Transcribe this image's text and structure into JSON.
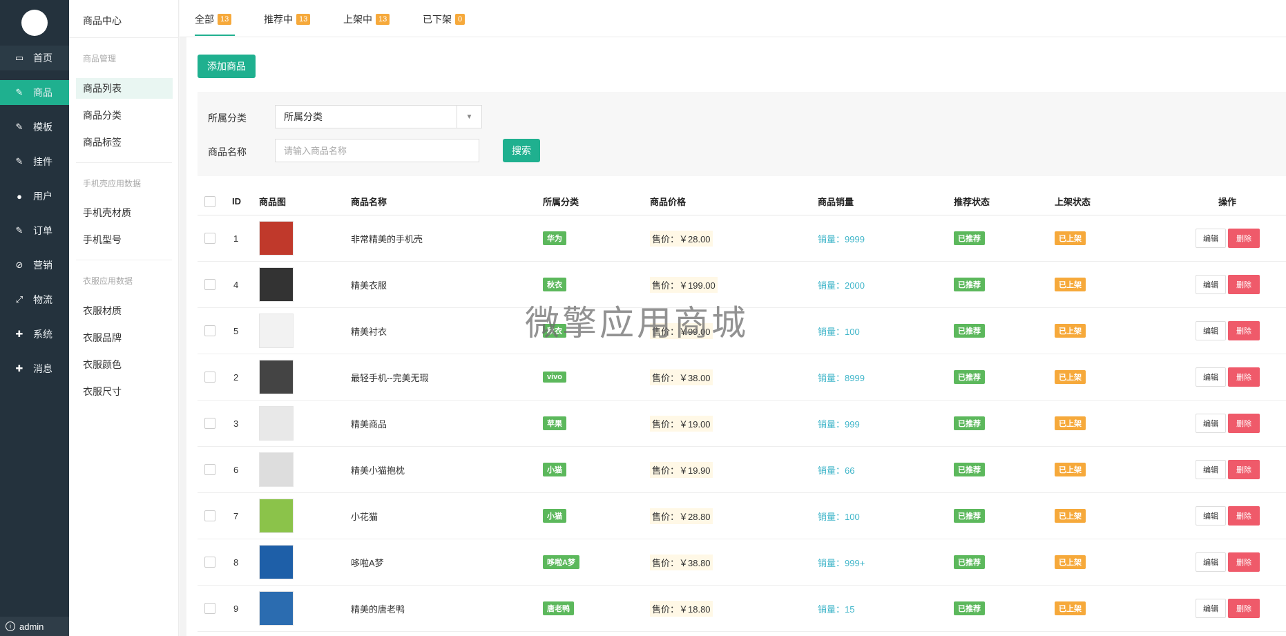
{
  "sidebar": {
    "items": [
      {
        "label": "首页",
        "icon": "monitor-icon",
        "glyph": "▭"
      },
      {
        "label": "商品",
        "icon": "pencil-icon",
        "glyph": "✎"
      },
      {
        "label": "模板",
        "icon": "pencil-icon",
        "glyph": "✎"
      },
      {
        "label": "挂件",
        "icon": "pencil-icon",
        "glyph": "✎"
      },
      {
        "label": "用户",
        "icon": "user-icon",
        "glyph": "●"
      },
      {
        "label": "订单",
        "icon": "pencil-icon",
        "glyph": "✎"
      },
      {
        "label": "营销",
        "icon": "ban-icon",
        "glyph": "⊘"
      },
      {
        "label": "物流",
        "icon": "expand-icon",
        "glyph": "⤢"
      },
      {
        "label": "系统",
        "icon": "plus-icon",
        "glyph": "✚"
      },
      {
        "label": "消息",
        "icon": "plus-icon",
        "glyph": "✚"
      }
    ],
    "user": "admin"
  },
  "subnav": {
    "header": "商品中心",
    "groups": [
      {
        "title": "商品管理",
        "items": [
          "商品列表",
          "商品分类",
          "商品标签"
        ]
      },
      {
        "title": "手机壳应用数据",
        "items": [
          "手机壳材质",
          "手机型号"
        ]
      },
      {
        "title": "衣服应用数据",
        "items": [
          "衣服材质",
          "衣服品牌",
          "衣服颜色",
          "衣服尺寸"
        ]
      }
    ]
  },
  "tabs": [
    {
      "label": "全部",
      "count": "13"
    },
    {
      "label": "推荐中",
      "count": "13"
    },
    {
      "label": "上架中",
      "count": "13"
    },
    {
      "label": "已下架",
      "count": "0"
    }
  ],
  "toolbar": {
    "add_label": "添加商品"
  },
  "filter": {
    "category_label": "所属分类",
    "category_value": "所属分类",
    "name_label": "商品名称",
    "name_placeholder": "请输入商品名称",
    "search_label": "搜索"
  },
  "table": {
    "headers": {
      "id": "ID",
      "image": "商品图",
      "name": "商品名称",
      "category": "所属分类",
      "price": "商品价格",
      "sales": "商品销量",
      "recommend": "推荐状态",
      "status": "上架状态",
      "actions": "操作"
    },
    "rows": [
      {
        "id": "1",
        "thumb": "phone-case-image",
        "name": "非常精美的手机壳",
        "category": "华为",
        "price": "售价：￥28.00",
        "sales": "销量：9999",
        "recommend": "已推荐",
        "status": "已上架"
      },
      {
        "id": "4",
        "thumb": "clothing-image",
        "name": "精美衣服",
        "category": "秋衣",
        "price": "售价：￥199.00",
        "sales": "销量：2000",
        "recommend": "已推荐",
        "status": "已上架"
      },
      {
        "id": "5",
        "thumb": "shirt-image",
        "name": "精美衬衣",
        "category": "秋衣",
        "price": "售价：￥99.00",
        "sales": "销量：100",
        "recommend": "已推荐",
        "status": "已上架"
      },
      {
        "id": "2",
        "thumb": "phone-image",
        "name": "最轻手机--完美无瑕",
        "category": "vivo",
        "price": "售价：￥38.00",
        "sales": "销量：8999",
        "recommend": "已推荐",
        "status": "已上架"
      },
      {
        "id": "3",
        "thumb": "product-image",
        "name": "精美商品",
        "category": "苹果",
        "price": "售价：￥19.00",
        "sales": "销量：999",
        "recommend": "已推荐",
        "status": "已上架"
      },
      {
        "id": "6",
        "thumb": "pillow-image",
        "name": "精美小猫抱枕",
        "category": "小猫",
        "price": "售价：￥19.90",
        "sales": "销量：66",
        "recommend": "已推荐",
        "status": "已上架"
      },
      {
        "id": "7",
        "thumb": "avocado-image",
        "name": "小花猫",
        "category": "小猫",
        "price": "售价：￥28.80",
        "sales": "销量：100",
        "recommend": "已推荐",
        "status": "已上架"
      },
      {
        "id": "8",
        "thumb": "doraemon-image",
        "name": "哆啦A梦",
        "category": "哆啦A梦",
        "price": "售价：￥38.80",
        "sales": "销量：999+",
        "recommend": "已推荐",
        "status": "已上架"
      },
      {
        "id": "9",
        "thumb": "duck-image",
        "name": "精美的唐老鸭",
        "category": "唐老鸭",
        "price": "售价：￥18.80",
        "sales": "销量：15",
        "recommend": "已推荐",
        "status": "已上架"
      }
    ],
    "edit_label": "编辑",
    "delete_label": "删除"
  },
  "watermark": "微擎应用商城",
  "colors": {
    "accent": "#1fb08f",
    "sidebar": "#24323d",
    "badge": "#f6a93b",
    "danger": "#ef5a6a",
    "tag": "#5cb85c",
    "sales": "#3fb5c9"
  }
}
